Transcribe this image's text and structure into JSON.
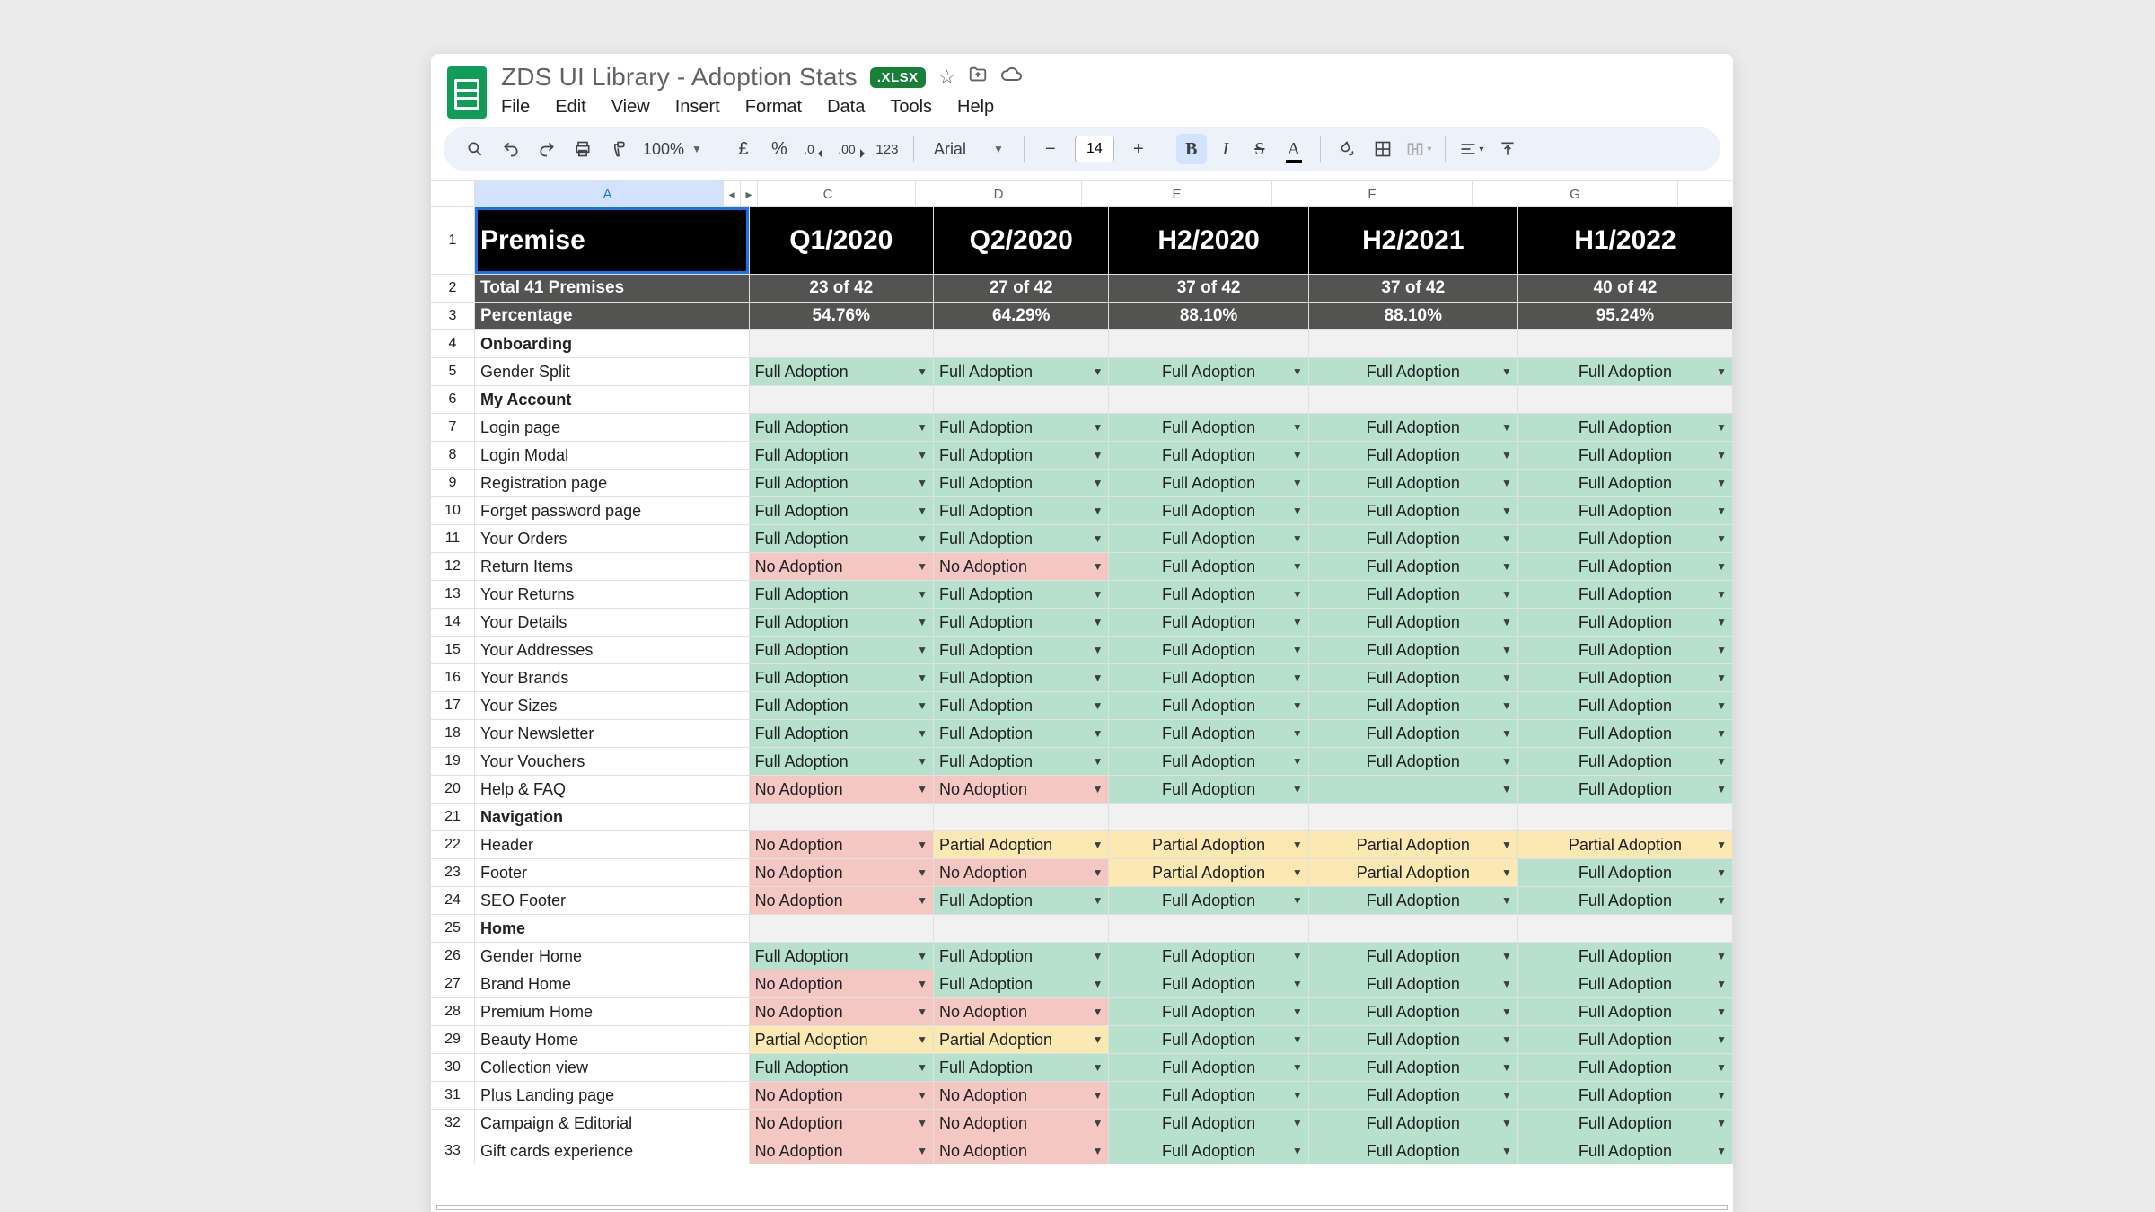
{
  "header": {
    "doc_title": "ZDS UI Library - Adoption Stats",
    "xlsx_badge": ".XLSX",
    "menus": [
      "File",
      "Edit",
      "View",
      "Insert",
      "Format",
      "Data",
      "Tools",
      "Help"
    ]
  },
  "toolbar": {
    "zoom": "100%",
    "font": "Arial",
    "font_size": "14"
  },
  "columns": [
    "A",
    "C",
    "D",
    "E",
    "F",
    "G"
  ],
  "periods": [
    "Q1/2020",
    "Q2/2020",
    "H2/2020",
    "H2/2021",
    "H1/2022"
  ],
  "summary": {
    "label": "Premise",
    "totals_label": "Total 41 Premises",
    "percent_label": "Percentage",
    "totals": [
      "23 of 42",
      "27 of 42",
      "37 of 42",
      "37 of 42",
      "40 of 42"
    ],
    "percents": [
      "54.76%",
      "64.29%",
      "88.10%",
      "88.10%",
      "95.24%"
    ]
  },
  "body": [
    {
      "n": 4,
      "type": "section",
      "label": "Onboarding"
    },
    {
      "n": 5,
      "type": "data",
      "label": "Gender Split",
      "v": [
        "Full Adoption",
        "Full Adoption",
        "Full Adoption",
        "Full Adoption",
        "Full Adoption"
      ]
    },
    {
      "n": 6,
      "type": "section",
      "label": "My Account"
    },
    {
      "n": 7,
      "type": "data",
      "label": "Login page",
      "v": [
        "Full Adoption",
        "Full Adoption",
        "Full Adoption",
        "Full Adoption",
        "Full Adoption"
      ]
    },
    {
      "n": 8,
      "type": "data",
      "label": "Login Modal",
      "v": [
        "Full Adoption",
        "Full Adoption",
        "Full Adoption",
        "Full Adoption",
        "Full Adoption"
      ]
    },
    {
      "n": 9,
      "type": "data",
      "label": "Registration page",
      "v": [
        "Full Adoption",
        "Full Adoption",
        "Full Adoption",
        "Full Adoption",
        "Full Adoption"
      ]
    },
    {
      "n": 10,
      "type": "data",
      "label": "Forget password page",
      "v": [
        "Full Adoption",
        "Full Adoption",
        "Full Adoption",
        "Full Adoption",
        "Full Adoption"
      ]
    },
    {
      "n": 11,
      "type": "data",
      "label": "Your Orders",
      "v": [
        "Full Adoption",
        "Full Adoption",
        "Full Adoption",
        "Full Adoption",
        "Full Adoption"
      ]
    },
    {
      "n": 12,
      "type": "data",
      "label": "Return Items",
      "v": [
        "No Adoption",
        "No Adoption",
        "Full Adoption",
        "Full Adoption",
        "Full Adoption"
      ]
    },
    {
      "n": 13,
      "type": "data",
      "label": "Your Returns",
      "v": [
        "Full Adoption",
        "Full Adoption",
        "Full Adoption",
        "Full Adoption",
        "Full Adoption"
      ]
    },
    {
      "n": 14,
      "type": "data",
      "label": "Your Details",
      "v": [
        "Full Adoption",
        "Full Adoption",
        "Full Adoption",
        "Full Adoption",
        "Full Adoption"
      ]
    },
    {
      "n": 15,
      "type": "data",
      "label": "Your Addresses",
      "v": [
        "Full Adoption",
        "Full Adoption",
        "Full Adoption",
        "Full Adoption",
        "Full Adoption"
      ]
    },
    {
      "n": 16,
      "type": "data",
      "label": "Your Brands",
      "v": [
        "Full Adoption",
        "Full Adoption",
        "Full Adoption",
        "Full Adoption",
        "Full Adoption"
      ]
    },
    {
      "n": 17,
      "type": "data",
      "label": "Your Sizes",
      "v": [
        "Full Adoption",
        "Full Adoption",
        "Full Adoption",
        "Full Adoption",
        "Full Adoption"
      ]
    },
    {
      "n": 18,
      "type": "data",
      "label": "Your Newsletter",
      "v": [
        "Full Adoption",
        "Full Adoption",
        "Full Adoption",
        "Full Adoption",
        "Full Adoption"
      ]
    },
    {
      "n": 19,
      "type": "data",
      "label": "Your Vouchers",
      "v": [
        "Full Adoption",
        "Full Adoption",
        "Full Adoption",
        "Full Adoption",
        "Full Adoption"
      ]
    },
    {
      "n": 20,
      "type": "data",
      "label": "Help & FAQ",
      "v": [
        "No Adoption",
        "No Adoption",
        "Full Adoption",
        "",
        "Full Adoption"
      ]
    },
    {
      "n": 21,
      "type": "section",
      "label": "Navigation"
    },
    {
      "n": 22,
      "type": "data",
      "label": "Header",
      "v": [
        "No Adoption",
        "Partial Adoption",
        "Partial Adoption",
        "Partial Adoption",
        "Partial Adoption"
      ]
    },
    {
      "n": 23,
      "type": "data",
      "label": "Footer",
      "v": [
        "No Adoption",
        "No Adoption",
        "Partial Adoption",
        "Partial Adoption",
        "Full Adoption"
      ]
    },
    {
      "n": 24,
      "type": "data",
      "label": "SEO Footer",
      "v": [
        "No Adoption",
        "Full Adoption",
        "Full Adoption",
        "Full Adoption",
        "Full Adoption"
      ]
    },
    {
      "n": 25,
      "type": "section",
      "label": "Home"
    },
    {
      "n": 26,
      "type": "data",
      "label": "Gender Home",
      "v": [
        "Full Adoption",
        "Full Adoption",
        "Full Adoption",
        "Full Adoption",
        "Full Adoption"
      ]
    },
    {
      "n": 27,
      "type": "data",
      "label": "Brand Home",
      "v": [
        "No Adoption",
        "Full Adoption",
        "Full Adoption",
        "Full Adoption",
        "Full Adoption"
      ]
    },
    {
      "n": 28,
      "type": "data",
      "label": "Premium Home",
      "v": [
        "No Adoption",
        "No Adoption",
        "Full Adoption",
        "Full Adoption",
        "Full Adoption"
      ]
    },
    {
      "n": 29,
      "type": "data",
      "label": "Beauty Home",
      "v": [
        "Partial Adoption",
        "Partial Adoption",
        "Full Adoption",
        "Full Adoption",
        "Full Adoption"
      ]
    },
    {
      "n": 30,
      "type": "data",
      "label": "Collection view",
      "v": [
        "Full Adoption",
        "Full Adoption",
        "Full Adoption",
        "Full Adoption",
        "Full Adoption"
      ]
    },
    {
      "n": 31,
      "type": "data",
      "label": "Plus Landing page",
      "v": [
        "No Adoption",
        "No Adoption",
        "Full Adoption",
        "Full Adoption",
        "Full Adoption"
      ]
    },
    {
      "n": 32,
      "type": "data",
      "label": "Campaign & Editorial",
      "v": [
        "No Adoption",
        "No Adoption",
        "Full Adoption",
        "Full Adoption",
        "Full Adoption"
      ]
    },
    {
      "n": 33,
      "type": "data",
      "label": "Gift cards experience",
      "v": [
        "No Adoption",
        "No Adoption",
        "Full Adoption",
        "Full Adoption",
        "Full Adoption"
      ]
    }
  ],
  "status_colors": {
    "Full Adoption": "green",
    "Partial Adoption": "yellow",
    "No Adoption": "red",
    "": "green"
  }
}
